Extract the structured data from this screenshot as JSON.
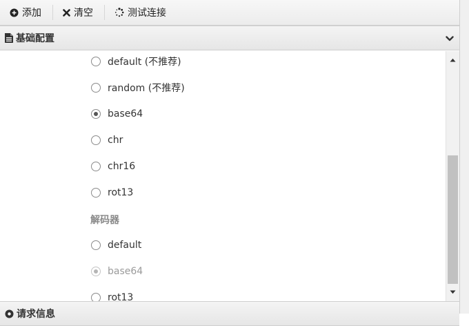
{
  "toolbar": {
    "add_label": "添加",
    "clear_label": "清空",
    "test_label": "测试连接"
  },
  "panels": {
    "basic": {
      "title": "基础配置"
    },
    "request": {
      "title": "请求信息"
    }
  },
  "encoder_options": [
    {
      "label": "default (不推荐)",
      "checked": false
    },
    {
      "label": "random (不推荐)",
      "checked": false
    },
    {
      "label": "base64",
      "checked": true
    },
    {
      "label": "chr",
      "checked": false
    },
    {
      "label": "chr16",
      "checked": false
    },
    {
      "label": "rot13",
      "checked": false
    }
  ],
  "decoder": {
    "group_label": "解码器",
    "options": [
      {
        "label": "default",
        "checked": false,
        "disabled": false
      },
      {
        "label": "base64",
        "checked": true,
        "disabled": true
      },
      {
        "label": "rot13",
        "checked": false,
        "disabled": false
      }
    ]
  },
  "colors": {
    "header_bg": "#ececec",
    "border": "#cfcfcf",
    "scroll_thumb": "#c1c1c1"
  },
  "icons": [
    "plus-circle-icon",
    "times-icon",
    "spinner-icon",
    "file-icon",
    "chevron-down-icon",
    "scroll-up-icon",
    "scroll-down-icon"
  ]
}
